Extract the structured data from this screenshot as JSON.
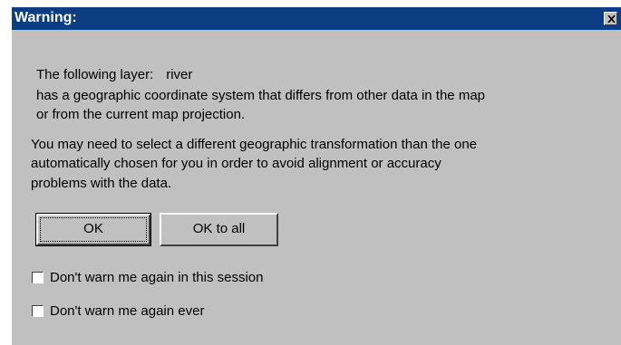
{
  "dialog": {
    "title": "Warning:",
    "layer_prefix": "The following layer:",
    "layer_name": "river",
    "message_line1": "has a geographic coordinate system that differs from other data in the map",
    "message_line2": "or from the current map projection.",
    "advice_line1": "You may need to select a different geographic transformation than the one",
    "advice_line2": "automatically chosen for you in order to avoid alignment or accuracy",
    "advice_line3": "problems with the data."
  },
  "buttons": {
    "ok_label": "OK",
    "ok_all_label": "OK to all"
  },
  "checkboxes": [
    {
      "label": "Don't warn me again in this session",
      "checked": false
    },
    {
      "label": "Don't warn me again ever",
      "checked": false
    }
  ],
  "colors": {
    "titlebar": "#0a3d82",
    "dialog_bg": "#c0c0c0"
  },
  "icons": {
    "close": "close-icon"
  }
}
